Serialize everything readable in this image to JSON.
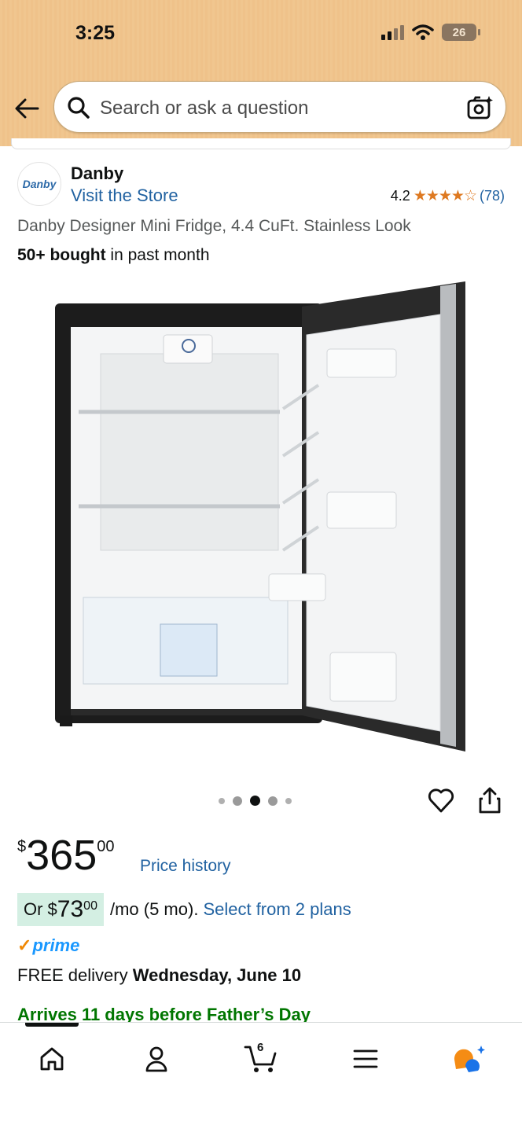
{
  "status_bar": {
    "time": "3:25",
    "battery": "26"
  },
  "search": {
    "placeholder": "Search or ask a question"
  },
  "brand": {
    "logo_text": "Danby",
    "name": "Danby",
    "store_link": "Visit the Store"
  },
  "rating": {
    "value": "4.2",
    "stars": "★★★★☆",
    "count": "(78)"
  },
  "product": {
    "title": "Danby Designer Mini Fridge, 4.4 CuFt. Stainless Look",
    "bought_bold": "50+ bought",
    "bought_rest": " in past month"
  },
  "gallery": {
    "dot_count": 5,
    "active_index": 2
  },
  "price": {
    "symbol": "$",
    "whole": "365",
    "fraction": "00",
    "history_link": "Price history"
  },
  "monthly": {
    "prefix": "Or $",
    "amount": "73",
    "cents": "00",
    "suffix": "/mo (5 mo).",
    "plans_link": "Select from 2 plans"
  },
  "prime": {
    "check": "✓",
    "label": "prime"
  },
  "delivery": {
    "prefix": "FREE delivery ",
    "date": "Wednesday, June 10"
  },
  "arrives": {
    "text": "Arrives 11 days before Father’s Day"
  },
  "nav": {
    "cart_count": "6"
  },
  "colors": {
    "header_bg": "#f0c68f",
    "link": "#2162a1",
    "star": "#de7921",
    "prime": "#1a98ff",
    "green": "#007600",
    "monthly_bg": "#d4efe3"
  },
  "icons": [
    "back-arrow-icon",
    "search-icon",
    "camera-icon",
    "heart-icon",
    "share-icon",
    "home-icon",
    "account-icon",
    "cart-icon",
    "menu-icon",
    "rufus-icon"
  ]
}
